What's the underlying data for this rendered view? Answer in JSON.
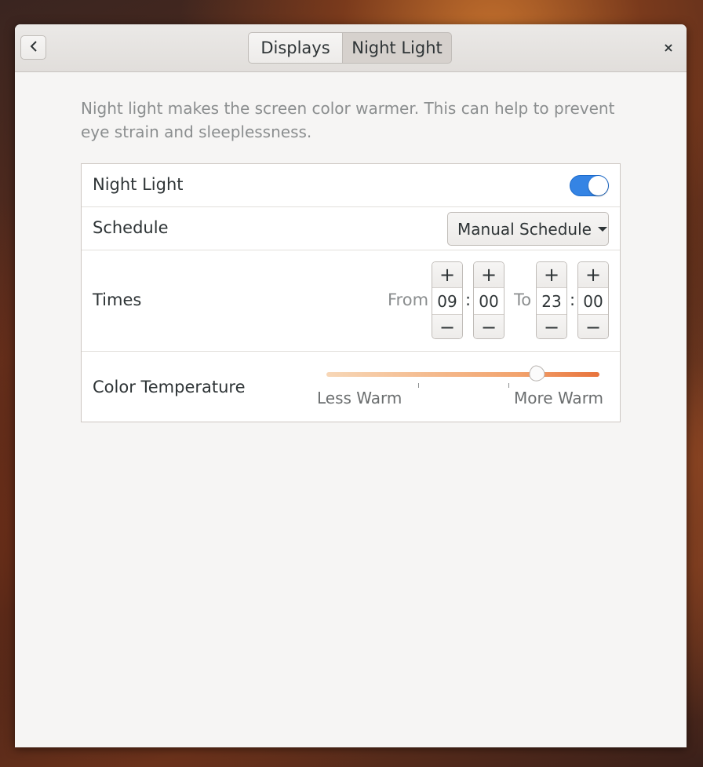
{
  "header": {
    "back_icon": "chevron-left-icon",
    "tabs": [
      {
        "label": "Displays",
        "active": false
      },
      {
        "label": "Night Light",
        "active": true
      }
    ],
    "close_label": "×"
  },
  "description": "Night light makes the screen color warmer. This can help to prevent eye strain and sleeplessness.",
  "settings": {
    "night_light": {
      "label": "Night Light",
      "enabled": true
    },
    "schedule": {
      "label": "Schedule",
      "value": "Manual Schedule"
    },
    "times": {
      "label": "Times",
      "from_label": "From",
      "to_label": "To",
      "from_hour": "09",
      "from_minute": "00",
      "to_hour": "23",
      "to_minute": "00",
      "separator": ":",
      "plus": "+",
      "minus": "−"
    },
    "color_temperature": {
      "label": "Color Temperature",
      "less_label": "Less Warm",
      "more_label": "More Warm",
      "level": 0.77
    }
  },
  "colors": {
    "accent": "#3584e4",
    "warm_end": "#e8733c"
  }
}
